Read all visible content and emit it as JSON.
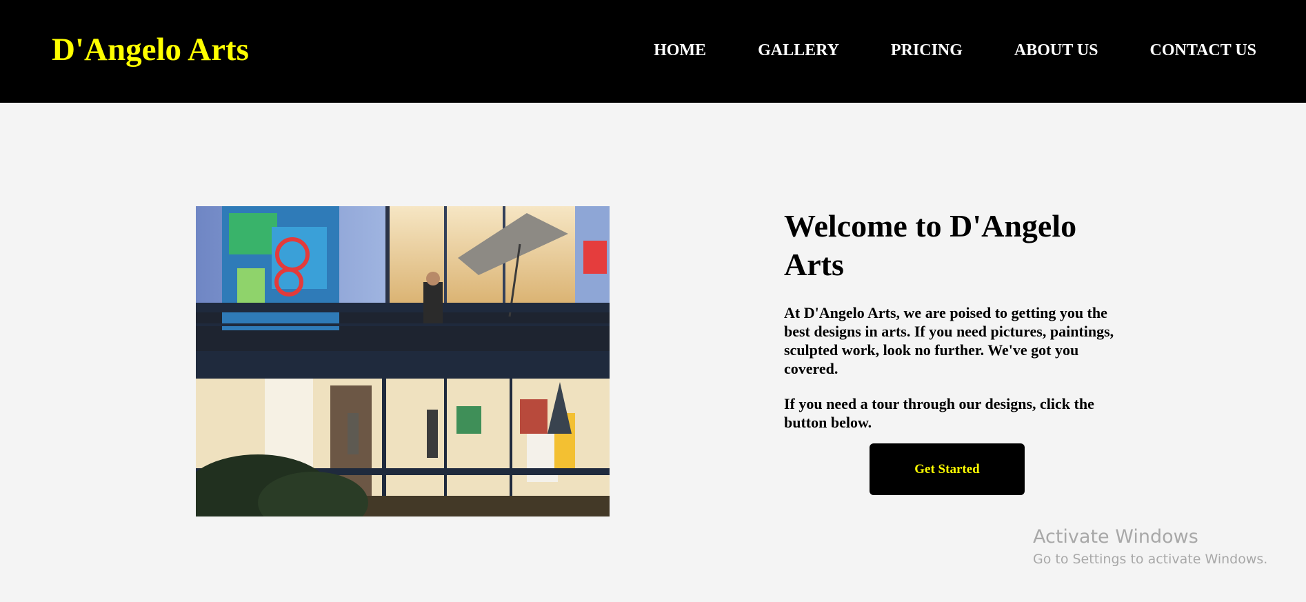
{
  "header": {
    "brand": "D'Angelo Arts",
    "nav": [
      "HOME",
      "GALLERY",
      "PRICING",
      "ABOUT US",
      "CONTACT US"
    ]
  },
  "hero": {
    "image_alt": "Gallery building at night with artwork on display",
    "title": "Welcome to D'Angelo Arts",
    "paragraph1": "At D'Angelo Arts, we are poised to getting you the best designs in arts. If you need pictures, paintings, sculpted work, look no further. We've got you covered.",
    "paragraph2": "If you need a tour through our designs, click the button below.",
    "cta_label": "Get Started"
  },
  "watermark": {
    "title": "Activate Windows",
    "subtitle": "Go to Settings to activate Windows."
  },
  "colors": {
    "header_bg": "#000000",
    "brand": "#ffff00",
    "nav_text": "#ffffff",
    "page_bg": "#f4f4f4",
    "cta_bg": "#000000",
    "cta_text": "#ffff00"
  }
}
